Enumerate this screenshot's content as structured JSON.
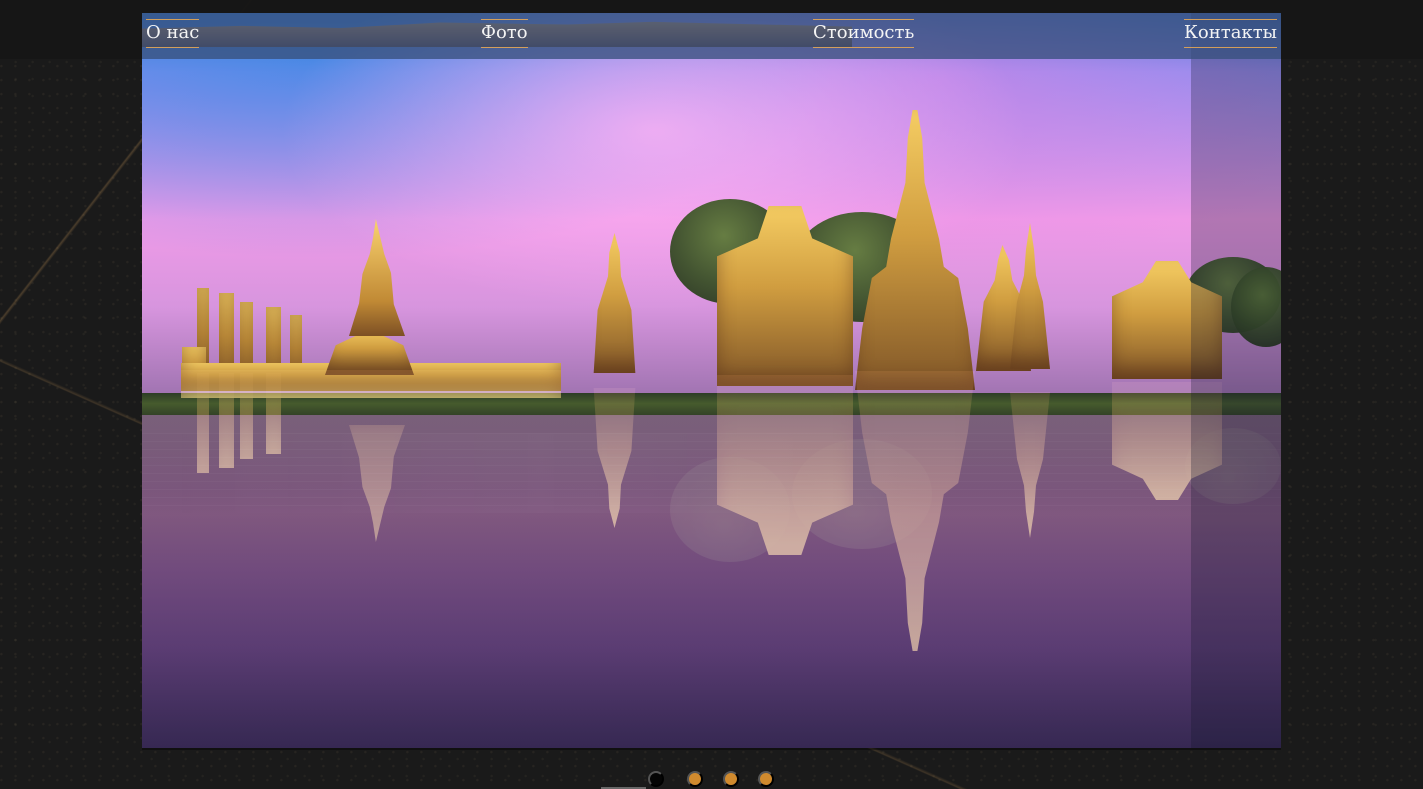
{
  "navigation": {
    "items": [
      {
        "label": "О нас"
      },
      {
        "label": "Фото"
      },
      {
        "label": "Стоимость"
      },
      {
        "label": "Контакты"
      }
    ]
  },
  "slider": {
    "current_slide": 1,
    "slide_count": 4
  },
  "colors": {
    "accent": "#d08a2e",
    "nav_overlay": "#39517d",
    "page_background": "#1a1a1a",
    "active_dot": "#050505"
  },
  "icons": {
    "pagination_dot_active": "filled-circle",
    "pagination_dot_inactive": "filled-circle"
  }
}
